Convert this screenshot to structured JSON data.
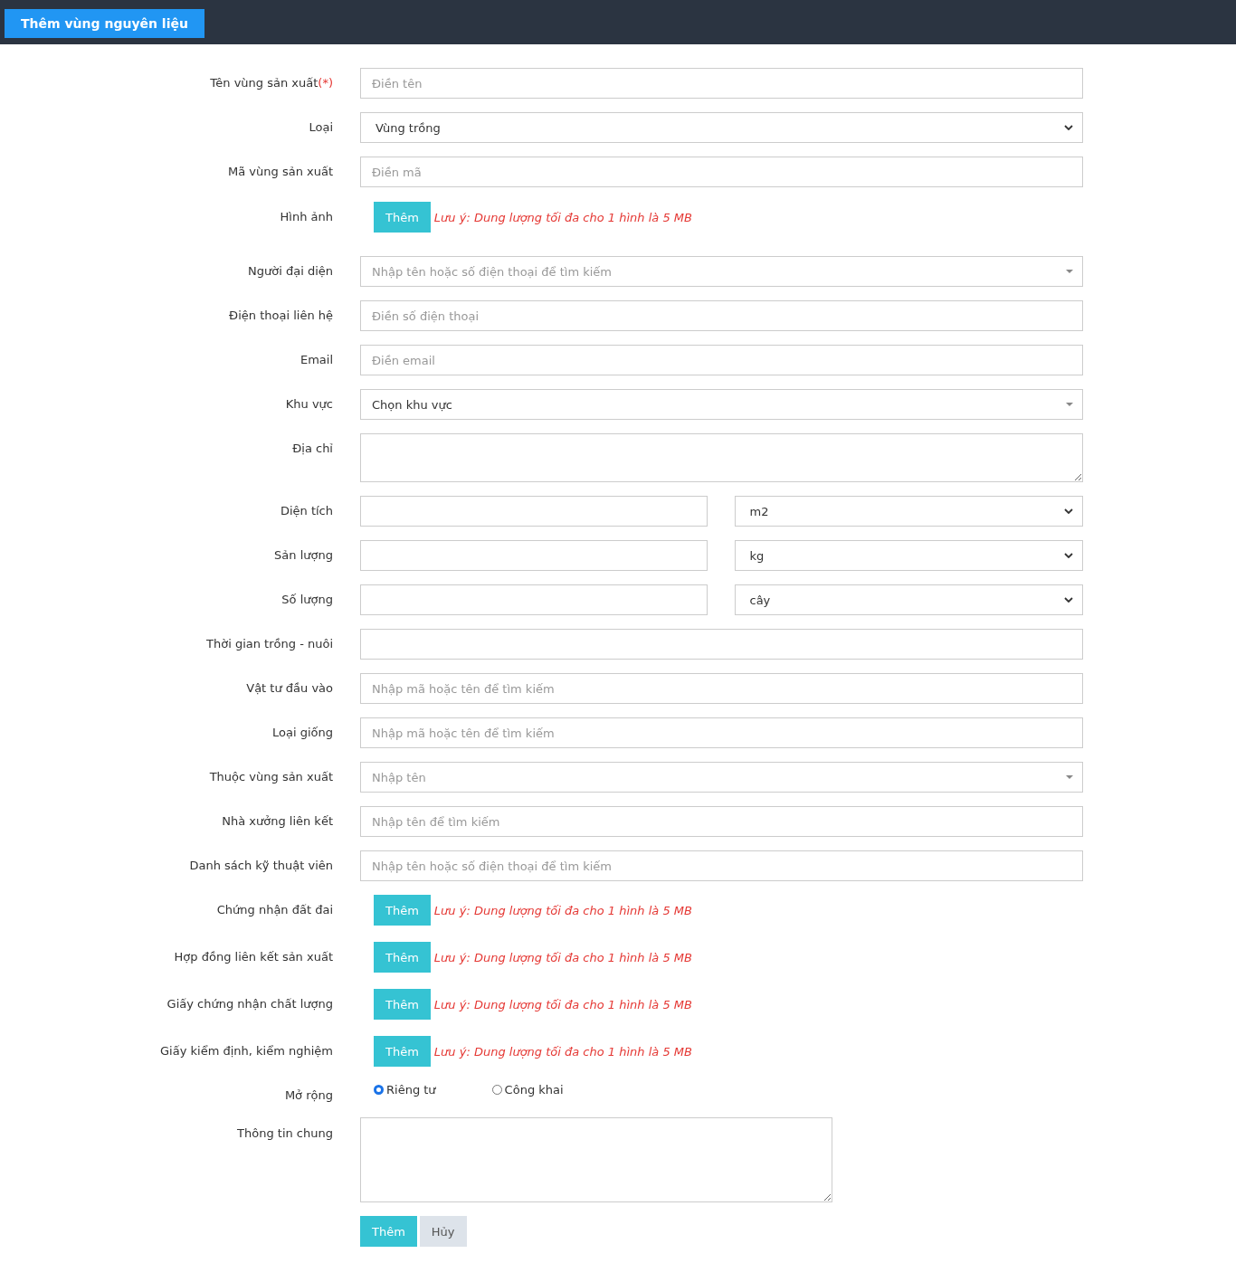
{
  "header": {
    "tab": {
      "label": "Thêm vùng nguyên liệu",
      "selected": true
    }
  },
  "form": {
    "rows": [
      {
        "kind": "input",
        "label": "Tên vùng sản xuất",
        "required_mark": "(*)",
        "placeholder": "Điền tên"
      },
      {
        "kind": "select",
        "label": "Loại",
        "value": "Vùng trồng"
      },
      {
        "kind": "input",
        "label": "Mã vùng sản xuất",
        "placeholder": "Điền mã"
      },
      {
        "kind": "file",
        "label": "Hình ảnh",
        "button": "Thêm",
        "note": "Lưu ý: Dung lượng tối đa cho 1 hình là 5 MB"
      },
      {
        "kind": "combo",
        "label": "Người đại diện",
        "placeholder": "Nhập tên hoặc số điện thoại để tìm kiếm"
      },
      {
        "kind": "input",
        "label": "Điện thoại liên hệ",
        "placeholder": "Điền số điện thoại"
      },
      {
        "kind": "input",
        "label": "Email",
        "placeholder": "Điền email"
      },
      {
        "kind": "combo",
        "label": "Khu vực",
        "value": "Chọn khu vực"
      },
      {
        "kind": "textarea",
        "label": "Địa chỉ"
      },
      {
        "kind": "unit",
        "label": "Diện tích",
        "unit": "m2"
      },
      {
        "kind": "unit",
        "label": "Sản lượng",
        "unit": "kg"
      },
      {
        "kind": "unit",
        "label": "Số lượng",
        "unit": "cây"
      },
      {
        "kind": "input",
        "label": "Thời gian trồng - nuôi"
      },
      {
        "kind": "input",
        "label": "Vật tư đầu vào",
        "placeholder": "Nhập mã hoặc tên để tìm kiếm"
      },
      {
        "kind": "input",
        "label": "Loại giống",
        "placeholder": "Nhập mã hoặc tên để tìm kiếm"
      },
      {
        "kind": "combo",
        "label": "Thuộc vùng sản xuất",
        "placeholder": "Nhập tên"
      },
      {
        "kind": "input",
        "label": "Nhà xưởng liên kết",
        "placeholder": "Nhập tên để tìm kiếm"
      },
      {
        "kind": "input",
        "label": "Danh sách kỹ thuật viên",
        "placeholder": "Nhập tên hoặc số điện thoại để tìm kiếm"
      },
      {
        "kind": "file",
        "label": "Chứng nhận đất đai",
        "button": "Thêm",
        "note": "Lưu ý: Dung lượng tối đa cho 1 hình là 5 MB"
      },
      {
        "kind": "file",
        "label": "Hợp đồng liên kết sản xuất",
        "button": "Thêm",
        "note": "Lưu ý: Dung lượng tối đa cho 1 hình là 5 MB"
      },
      {
        "kind": "file",
        "label": "Giấy chứng nhận chất lượng",
        "button": "Thêm",
        "note": "Lưu ý: Dung lượng tối đa cho 1 hình là 5 MB"
      },
      {
        "kind": "file",
        "label": "Giấy kiểm định, kiểm nghiệm",
        "button": "Thêm",
        "note": "Lưu ý: Dung lượng tối đa cho 1 hình là 5 MB"
      },
      {
        "kind": "radio",
        "label": "Mở rộng",
        "options": [
          {
            "label": "Riêng tư",
            "selected": true
          },
          {
            "label": "Công khai",
            "selected": false
          }
        ]
      },
      {
        "kind": "bigtext",
        "label": "Thông tin chung"
      }
    ],
    "buttons": [
      {
        "label": "Thêm",
        "kind": "primary"
      },
      {
        "label": "Hủy",
        "kind": "secondary"
      }
    ]
  }
}
